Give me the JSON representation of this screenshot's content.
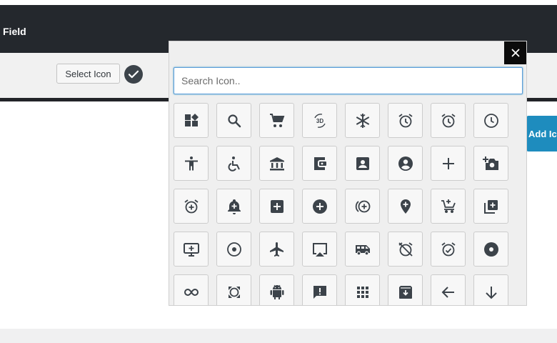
{
  "header": {
    "title": "Field"
  },
  "toolbar": {
    "select_icon_label": "Select Icon"
  },
  "actions": {
    "add_label": "Add Ic"
  },
  "modal": {
    "close_symbol": "×",
    "search": {
      "placeholder": "Search Icon..",
      "value": ""
    }
  },
  "icons": [
    "widgets-icon",
    "search-icon",
    "shopping-cart-icon",
    "3d-rotation-icon",
    "ac-unit-icon",
    "access-alarm-icon",
    "access-alarms-icon",
    "access-time-icon",
    "accessibility-icon",
    "accessible-icon",
    "account-balance-icon",
    "account-balance-wallet-icon",
    "account-box-icon",
    "account-circle-icon",
    "add-icon",
    "add-a-photo-icon",
    "add-alarm-icon",
    "add-alert-icon",
    "add-box-icon",
    "add-circle-icon",
    "add-circle-outline-icon",
    "add-location-icon",
    "add-shopping-cart-icon",
    "add-to-photos-icon",
    "add-to-queue-icon",
    "adjust-icon",
    "airplanemode-active-icon",
    "airplay-icon",
    "airport-shuttle-icon",
    "alarm-off-icon",
    "alarm-on-icon",
    "album-icon",
    "all-inclusive-icon",
    "all-out-icon",
    "android-icon",
    "announcement-icon",
    "apps-icon",
    "archive-icon",
    "arrow-back-icon",
    "arrow-downward-icon"
  ]
}
